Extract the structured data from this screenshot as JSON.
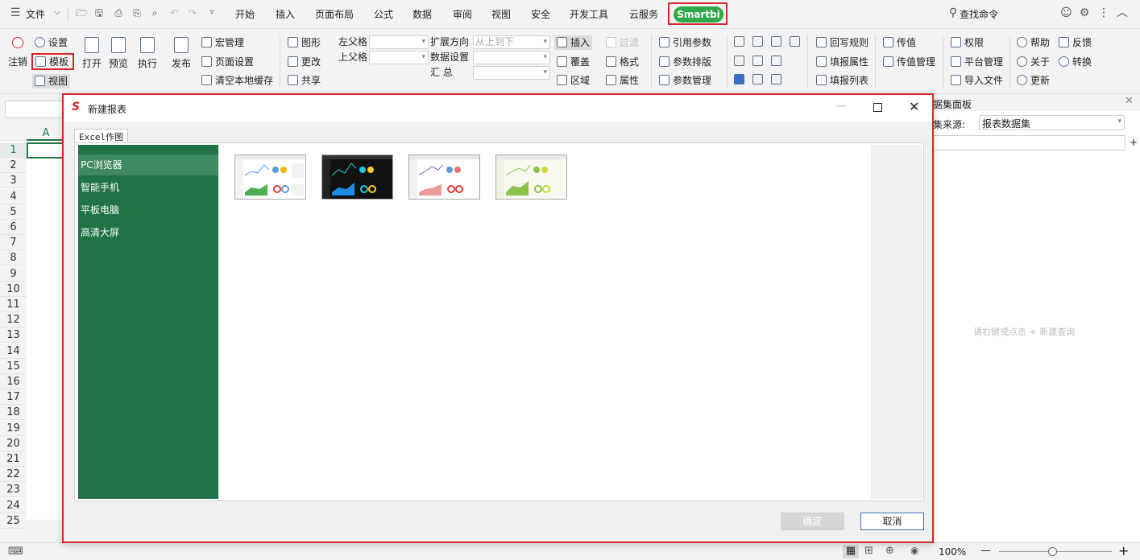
{
  "menubar": {
    "file": "文件",
    "tabs": [
      "开始",
      "插入",
      "页面布局",
      "公式",
      "数据",
      "审阅",
      "视图",
      "安全",
      "开发工具",
      "云服务"
    ],
    "smartbi": "Smartbi",
    "search": "查找命令"
  },
  "ribbon": {
    "logout": "注销",
    "settings": "设置",
    "template": "模板",
    "view": "视图",
    "open": "打开",
    "preview": "预览",
    "execute": "执行",
    "publish": "发布",
    "macro": "宏管理",
    "page_setup": "页面设置",
    "clear_cache": "清空本地缓存",
    "chart": "图形",
    "change": "更改",
    "share": "共享",
    "left_parent": "左父格",
    "up_parent": "上父格",
    "expand_dir": "扩展方向",
    "expand_value": "从上到下",
    "data_setting": "数据设置",
    "summary": "汇  总",
    "insert": "插入",
    "overwrite": "覆盖",
    "region": "区域",
    "filter": "过滤",
    "format": "格式",
    "property": "属性",
    "ref_param": "引用参数",
    "param_layout": "参数排版",
    "param_mgmt": "参数管理",
    "writeback": "回写规则",
    "fill_prop": "填报属性",
    "fill_list": "填报列表",
    "pass_value": "传值",
    "pass_mgmt": "传值管理",
    "permission": "权限",
    "platform_mgmt": "平台管理",
    "import_file": "导入文件",
    "help": "帮助",
    "about": "关于",
    "update": "更新",
    "feedback": "反馈",
    "convert": "转换"
  },
  "sheet": {
    "col_a": "A",
    "rows": [
      "1",
      "2",
      "3",
      "4",
      "5",
      "6",
      "7",
      "8",
      "9",
      "10",
      "11",
      "12",
      "13",
      "14",
      "15",
      "16",
      "17",
      "18",
      "19",
      "20",
      "21",
      "22",
      "23",
      "24",
      "25"
    ]
  },
  "dataset_panel": {
    "title": "据集面板",
    "source_label": "集来源:",
    "source_value": "报表数据集",
    "hint": "请右键或点击 + 新建查询"
  },
  "status": {
    "zoom": "100%"
  },
  "dialog": {
    "title": "新建报表",
    "tab": "Excel作图",
    "nav": [
      "PC浏览器",
      "智能手机",
      "平板电脑",
      "高清大屏"
    ],
    "ok": "确定",
    "cancel": "取消"
  },
  "colors": {
    "accent": "#1f7b46",
    "nav_bg": "#217346",
    "nav_active": "#3e8a5e",
    "highlight": "#d9262c",
    "smartbi": "#2ea84a"
  }
}
